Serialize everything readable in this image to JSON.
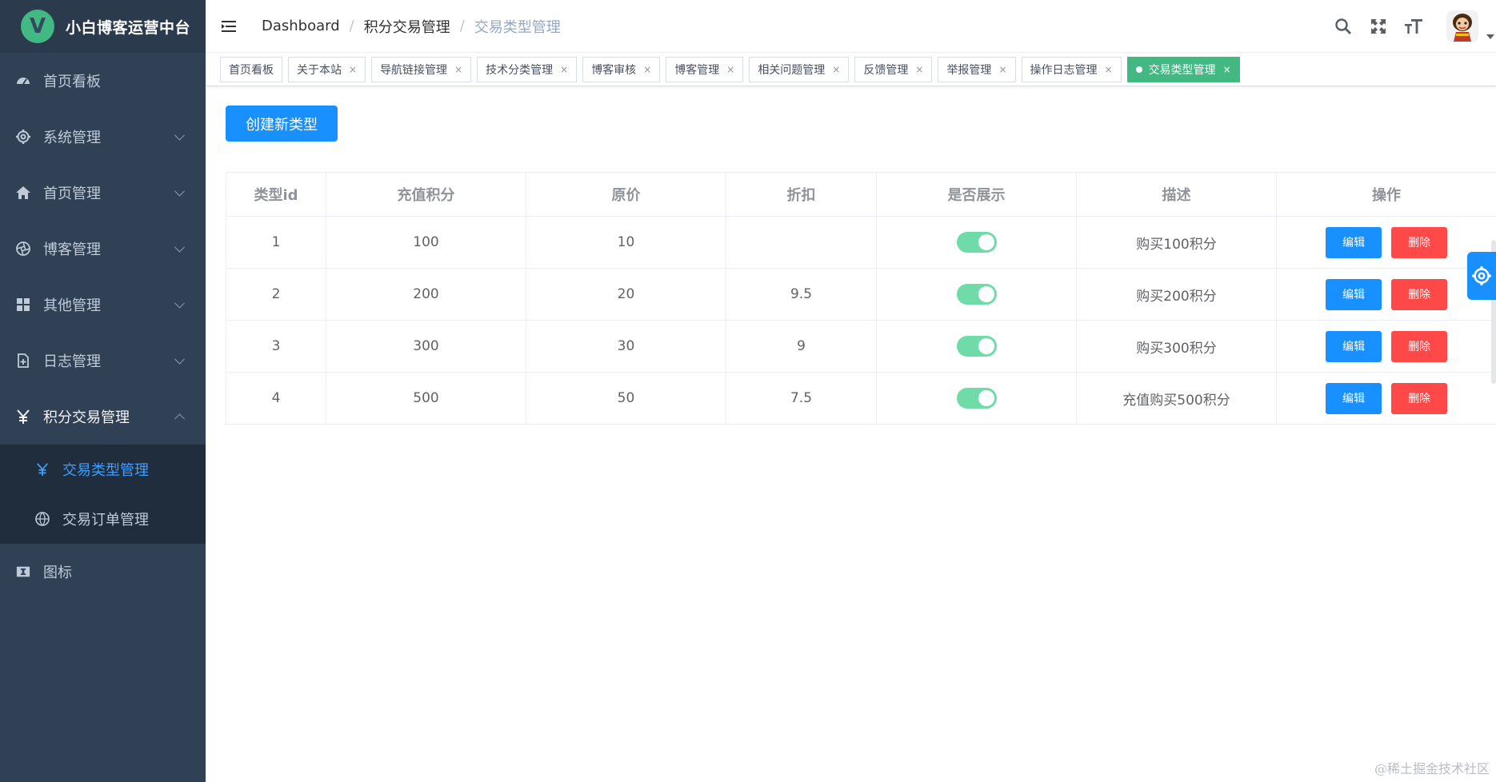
{
  "brand": {
    "logo_letter": "V",
    "title": "小白博客运营中台"
  },
  "sidebar": {
    "items": [
      {
        "label": "首页看板"
      },
      {
        "label": "系统管理"
      },
      {
        "label": "首页管理"
      },
      {
        "label": "博客管理"
      },
      {
        "label": "其他管理"
      },
      {
        "label": "日志管理"
      },
      {
        "label": "积分交易管理"
      }
    ],
    "sub_items": [
      {
        "label": "交易类型管理",
        "active": true
      },
      {
        "label": "交易订单管理"
      }
    ],
    "last_item": {
      "label": "图标"
    }
  },
  "breadcrumb": {
    "items": [
      "Dashboard",
      "积分交易管理",
      "交易类型管理"
    ],
    "separator": "/"
  },
  "tags": [
    {
      "label": "首页看板"
    },
    {
      "label": "关于本站"
    },
    {
      "label": "导航链接管理"
    },
    {
      "label": "技术分类管理"
    },
    {
      "label": "博客审核"
    },
    {
      "label": "博客管理"
    },
    {
      "label": "相关问题管理"
    },
    {
      "label": "反馈管理"
    },
    {
      "label": "举报管理"
    },
    {
      "label": "操作日志管理"
    },
    {
      "label": "交易类型管理",
      "active": true
    }
  ],
  "tag_close": "×",
  "create_button": "创建新类型",
  "table": {
    "headers": [
      "类型id",
      "充值积分",
      "原价",
      "折扣",
      "是否展示",
      "描述",
      "操作"
    ],
    "rows": [
      {
        "id": "1",
        "points": "100",
        "price": "10",
        "discount": "",
        "shown": true,
        "desc": "购买100积分"
      },
      {
        "id": "2",
        "points": "200",
        "price": "20",
        "discount": "9.5",
        "shown": true,
        "desc": "购买200积分"
      },
      {
        "id": "3",
        "points": "300",
        "price": "30",
        "discount": "9",
        "shown": true,
        "desc": "购买300积分"
      },
      {
        "id": "4",
        "points": "500",
        "price": "50",
        "discount": "7.5",
        "shown": true,
        "desc": "充值购买500积分"
      }
    ],
    "edit_label": "编辑",
    "delete_label": "删除"
  },
  "watermark": "@稀土掘金技术社区",
  "colors": {
    "sidebar_bg": "#304156",
    "primary": "#1890ff",
    "danger": "#ff4949",
    "tag_active": "#42b983",
    "switch_on": "#6fdba8"
  },
  "icons": {
    "hamburger": "hamburger-icon",
    "search": "search-icon",
    "fullscreen": "fullscreen-icon",
    "font_size": "font-size-icon",
    "settings": "gear-icon"
  }
}
